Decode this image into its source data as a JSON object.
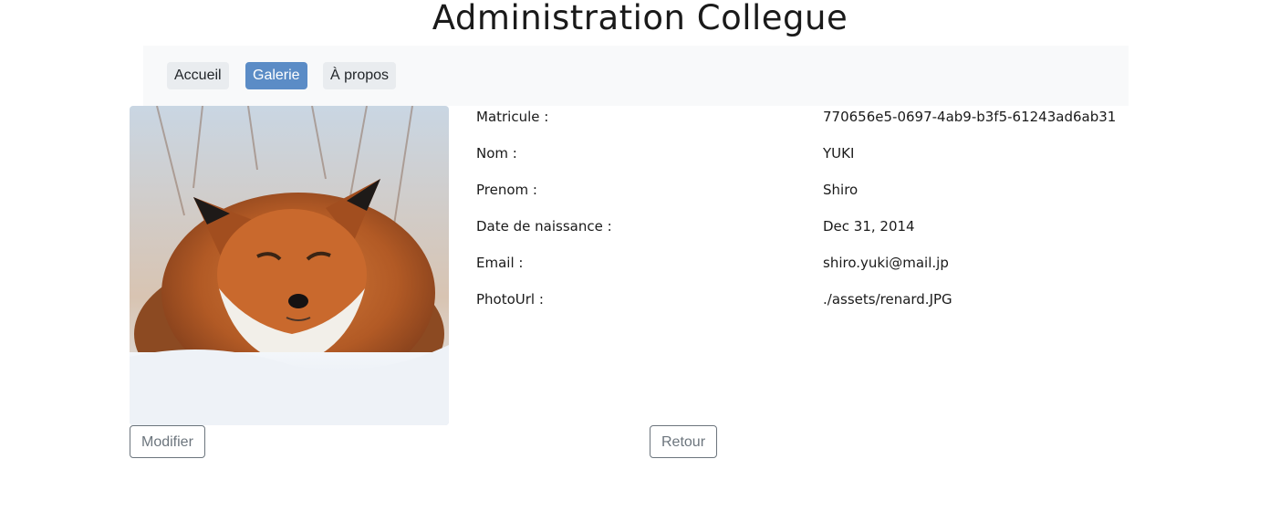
{
  "header": {
    "title": "Administration Collegue"
  },
  "nav": {
    "items": [
      {
        "label": "Accueil",
        "active": false
      },
      {
        "label": "Galerie",
        "active": true
      },
      {
        "label": "À propos",
        "active": false
      }
    ]
  },
  "photo": {
    "subject": "fox-photo",
    "accent": "#b8602a"
  },
  "details": [
    {
      "label": "Matricule :",
      "value": "770656e5-0697-4ab9-b3f5-61243ad6ab31"
    },
    {
      "label": "Nom :",
      "value": "YUKI"
    },
    {
      "label": "Prenom :",
      "value": "Shiro"
    },
    {
      "label": "Date de naissance :",
      "value": "Dec 31, 2014"
    },
    {
      "label": "Email :",
      "value": "shiro.yuki@mail.jp"
    },
    {
      "label": "PhotoUrl :",
      "value": "./assets/renard.JPG"
    }
  ],
  "actions": {
    "modify_label": "Modifier",
    "back_label": "Retour"
  },
  "colors": {
    "navbar_bg": "#f8f9fa",
    "active_nav": "#5b8cc6",
    "outline": "#6c757d"
  }
}
